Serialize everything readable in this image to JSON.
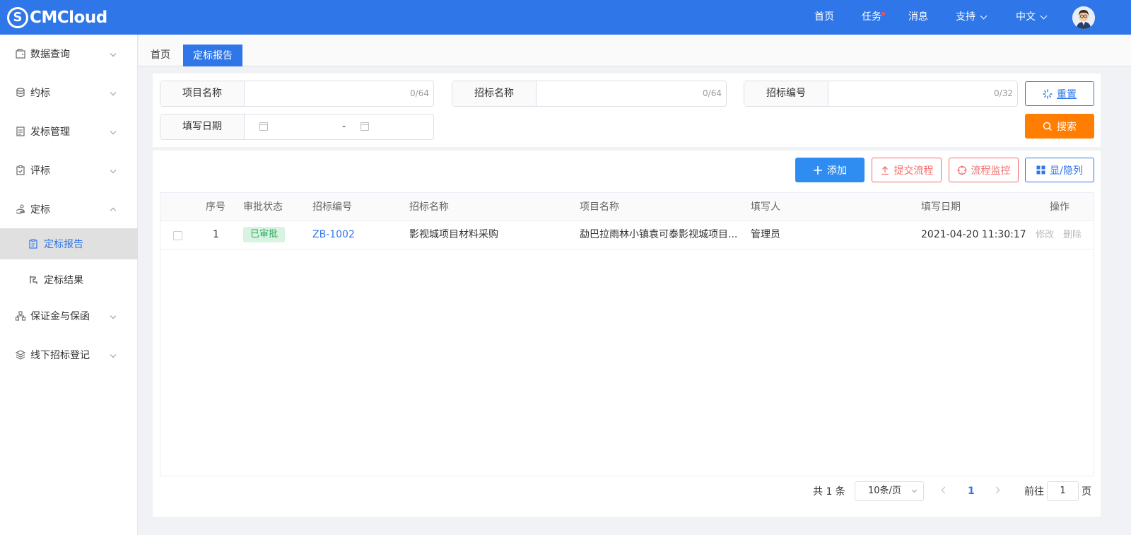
{
  "app": {
    "logo_mark": "S",
    "logo_text": "CMCloud"
  },
  "topnav": {
    "home": "首页",
    "tasks": "任务",
    "messages": "消息",
    "support": "支持",
    "language": "中文"
  },
  "sidebar": {
    "items": [
      {
        "label": "数据查询"
      },
      {
        "label": "约标"
      },
      {
        "label": "发标管理"
      },
      {
        "label": "评标"
      },
      {
        "label": "定标"
      },
      {
        "label": "保证金与保函"
      },
      {
        "label": "线下招标登记"
      }
    ],
    "sub_items": [
      {
        "label": "定标报告"
      },
      {
        "label": "定标结果"
      }
    ]
  },
  "tabs": {
    "home": "首页",
    "active": "定标报告"
  },
  "search": {
    "project_name_label": "项目名称",
    "project_name_count": "0/64",
    "tender_name_label": "招标名称",
    "tender_name_count": "0/64",
    "tender_no_label": "招标编号",
    "tender_no_count": "0/32",
    "fill_date_label": "填写日期",
    "date_separator": "-",
    "reset_label": "重置",
    "search_label": "搜索"
  },
  "toolbar": {
    "add_label": "添加",
    "submit_label": "提交流程",
    "monitor_label": "流程监控",
    "columns_label": "显/隐列"
  },
  "table": {
    "columns": [
      "序号",
      "审批状态",
      "招标编号",
      "招标名称",
      "项目名称",
      "填写人",
      "填写日期",
      "操作"
    ],
    "rows": [
      {
        "index": "1",
        "status": "已审批",
        "tender_no": "ZB-1002",
        "tender_name": "影视城项目材料采购",
        "project_name": "勐巴拉雨林小镇袁可泰影视城项目...",
        "filler": "管理员",
        "date": "2021-04-20 11:30:17",
        "edit": "修改",
        "delete": "删除"
      }
    ]
  },
  "pagination": {
    "total_text": "共 1 条",
    "page_size": "10条/页",
    "current_page": "1",
    "goto_prefix": "前往",
    "goto_value": "1",
    "goto_suffix": "页"
  },
  "colors": {
    "primary": "#2f76e8",
    "search_button": "#ff7d00",
    "add_button": "#2f8cf0",
    "danger_outline": "#f56c6c",
    "approved_badge_bg": "#d8f3e2",
    "approved_badge_text": "#2baa5b"
  },
  "icons": {
    "sidebar": [
      "wallet-icon",
      "coins-icon",
      "document-icon",
      "clipboard-check-icon",
      "hand-icon",
      "org-icon",
      "layers-icon"
    ],
    "reset": "loading-spinner-icon",
    "search": "search-icon",
    "add": "plus-icon",
    "submit": "upload-icon",
    "monitor": "target-icon",
    "columns": "grid-icon"
  }
}
